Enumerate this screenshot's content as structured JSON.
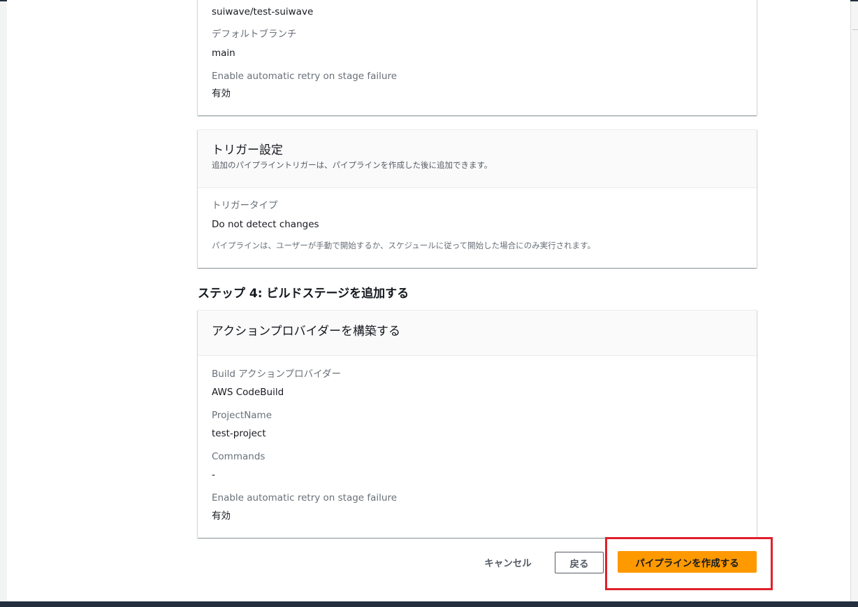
{
  "source_card": {
    "repository_value": "suiwave/test-suiwave",
    "default_branch_label": "デフォルトブランチ",
    "default_branch_value": "main",
    "retry_label": "Enable automatic retry on stage failure",
    "retry_value": "有効"
  },
  "trigger_card": {
    "title": "トリガー設定",
    "description": "追加のパイプライントリガーは、パイプラインを作成した後に追加できます。",
    "trigger_type_label": "トリガータイプ",
    "trigger_type_value": "Do not detect changes",
    "trigger_type_hint": "パイプラインは、ユーザーが手動で開始するか、スケジュールに従って開始した場合にのみ実行されます。"
  },
  "step4": {
    "heading": "ステップ 4: ビルドステージを追加する",
    "card_title": "アクションプロバイダーを構築する",
    "provider_label": "Build アクションプロバイダー",
    "provider_value": "AWS CodeBuild",
    "project_label": "ProjectName",
    "project_value": "test-project",
    "commands_label": "Commands",
    "commands_value": "-",
    "retry_label": "Enable automatic retry on stage failure",
    "retry_value": "有効"
  },
  "actions": {
    "cancel_label": "キャンセル",
    "back_label": "戻る",
    "create_label": "パイプラインを作成する"
  },
  "colors": {
    "primary_button": "#ff9900",
    "highlight": "#e0202b",
    "header_bar": "#232f3e"
  }
}
